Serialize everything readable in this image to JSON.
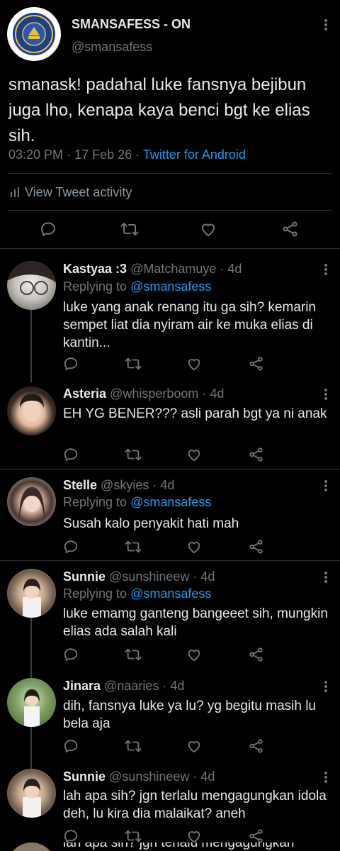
{
  "main_tweet": {
    "display_name": "SMANSAFESS - ON",
    "handle": "@smansafess",
    "text": "smanask! padahal luke fansnya bejibun juga lho, kenapa kaya benci bgt ke elias sih.",
    "time": "03:20 PM",
    "date": "17 Feb 26",
    "source": "Twitter for Android",
    "activity_label": "View Tweet activity"
  },
  "replies": [
    {
      "name": "Kastyaa :3",
      "handle": "@Matchamuye",
      "age": "· 4d",
      "replying_to": "Replying to",
      "replying_handle": "@smansafess",
      "text": "luke yang anak renang itu ga sih? kemarin sempet liat dia nyiram air ke muka elias di kantin..."
    },
    {
      "name": "Asteria",
      "handle": "@whisperboom",
      "age": "· 4d",
      "replying_to": "",
      "replying_handle": "",
      "text": "EH YG BENER??? asli parah bgt ya ni anak"
    },
    {
      "name": "Stelle",
      "handle": "@skyies",
      "age": "· 4d",
      "replying_to": "Replying to",
      "replying_handle": "@smansafess",
      "text": "Susah kalo penyakit hati mah"
    },
    {
      "name": "Sunnie",
      "handle": "@sunshineew",
      "age": "· 4d",
      "replying_to": "Replying to",
      "replying_handle": "@smansafess",
      "text": "luke emamg ganteng bangeeet sih, mungkin elias ada salah kali"
    },
    {
      "name": "Jinara",
      "handle": "@naaries",
      "age": "· 4d",
      "replying_to": "",
      "replying_handle": "",
      "text": "dih, fansnya luke ya lu? yg begitu masih lu bela aja"
    },
    {
      "name": "Sunnie",
      "handle": "@sunshineew",
      "age": "· 4d",
      "replying_to": "",
      "replying_handle": "",
      "text": "lah apa sih? jgn terlalu mengagungkan idola deh, lu kira dia malaikat? aneh"
    }
  ],
  "cutoff_text": "lah apa sih? jgn terlalu mengagungkan",
  "colors": {
    "background": "#000000",
    "text": "#e7e9ea",
    "muted": "#71767b",
    "link": "#1d9bf0",
    "divider": "#2f3336"
  },
  "icons": [
    "reply-icon",
    "retweet-icon",
    "like-icon",
    "share-icon",
    "more-icon",
    "activity-icon"
  ]
}
